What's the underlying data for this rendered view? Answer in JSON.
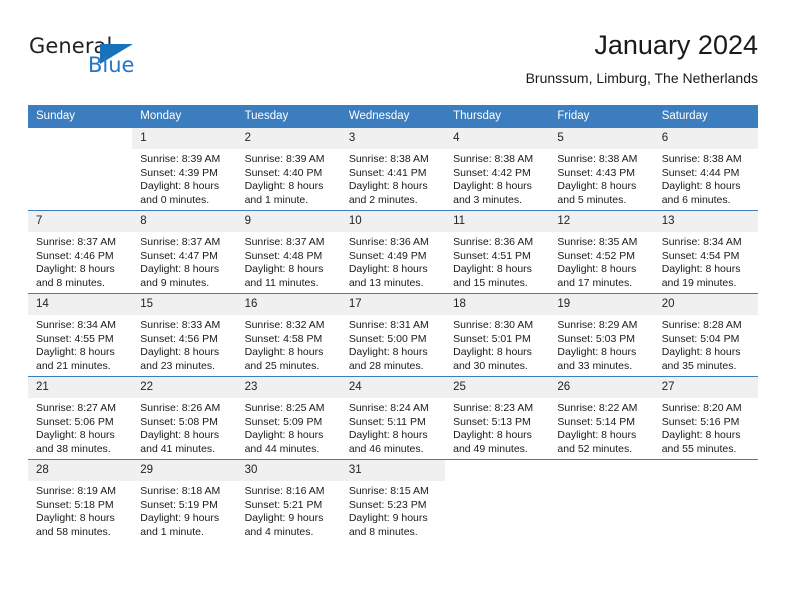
{
  "brand": {
    "name_part1": "General",
    "name_part2": "Blue",
    "logo_icon": "triangle-icon",
    "accent_color": "#1872bb"
  },
  "header": {
    "title": "January 2024",
    "subtitle": "Brunssum, Limburg, The Netherlands"
  },
  "theme": {
    "header_row_bg": "#3b7dbf",
    "day_number_bg": "#f0f0f0",
    "grid_line": "#3b7dbf"
  },
  "calendar": {
    "weekday_headers": [
      "Sunday",
      "Monday",
      "Tuesday",
      "Wednesday",
      "Thursday",
      "Friday",
      "Saturday"
    ],
    "weeks": [
      [
        {
          "day": "",
          "lines": []
        },
        {
          "day": "1",
          "lines": [
            "Sunrise: 8:39 AM",
            "Sunset: 4:39 PM",
            "Daylight: 8 hours",
            "and 0 minutes."
          ]
        },
        {
          "day": "2",
          "lines": [
            "Sunrise: 8:39 AM",
            "Sunset: 4:40 PM",
            "Daylight: 8 hours",
            "and 1 minute."
          ]
        },
        {
          "day": "3",
          "lines": [
            "Sunrise: 8:38 AM",
            "Sunset: 4:41 PM",
            "Daylight: 8 hours",
            "and 2 minutes."
          ]
        },
        {
          "day": "4",
          "lines": [
            "Sunrise: 8:38 AM",
            "Sunset: 4:42 PM",
            "Daylight: 8 hours",
            "and 3 minutes."
          ]
        },
        {
          "day": "5",
          "lines": [
            "Sunrise: 8:38 AM",
            "Sunset: 4:43 PM",
            "Daylight: 8 hours",
            "and 5 minutes."
          ]
        },
        {
          "day": "6",
          "lines": [
            "Sunrise: 8:38 AM",
            "Sunset: 4:44 PM",
            "Daylight: 8 hours",
            "and 6 minutes."
          ]
        }
      ],
      [
        {
          "day": "7",
          "lines": [
            "Sunrise: 8:37 AM",
            "Sunset: 4:46 PM",
            "Daylight: 8 hours",
            "and 8 minutes."
          ]
        },
        {
          "day": "8",
          "lines": [
            "Sunrise: 8:37 AM",
            "Sunset: 4:47 PM",
            "Daylight: 8 hours",
            "and 9 minutes."
          ]
        },
        {
          "day": "9",
          "lines": [
            "Sunrise: 8:37 AM",
            "Sunset: 4:48 PM",
            "Daylight: 8 hours",
            "and 11 minutes."
          ]
        },
        {
          "day": "10",
          "lines": [
            "Sunrise: 8:36 AM",
            "Sunset: 4:49 PM",
            "Daylight: 8 hours",
            "and 13 minutes."
          ]
        },
        {
          "day": "11",
          "lines": [
            "Sunrise: 8:36 AM",
            "Sunset: 4:51 PM",
            "Daylight: 8 hours",
            "and 15 minutes."
          ]
        },
        {
          "day": "12",
          "lines": [
            "Sunrise: 8:35 AM",
            "Sunset: 4:52 PM",
            "Daylight: 8 hours",
            "and 17 minutes."
          ]
        },
        {
          "day": "13",
          "lines": [
            "Sunrise: 8:34 AM",
            "Sunset: 4:54 PM",
            "Daylight: 8 hours",
            "and 19 minutes."
          ]
        }
      ],
      [
        {
          "day": "14",
          "lines": [
            "Sunrise: 8:34 AM",
            "Sunset: 4:55 PM",
            "Daylight: 8 hours",
            "and 21 minutes."
          ]
        },
        {
          "day": "15",
          "lines": [
            "Sunrise: 8:33 AM",
            "Sunset: 4:56 PM",
            "Daylight: 8 hours",
            "and 23 minutes."
          ]
        },
        {
          "day": "16",
          "lines": [
            "Sunrise: 8:32 AM",
            "Sunset: 4:58 PM",
            "Daylight: 8 hours",
            "and 25 minutes."
          ]
        },
        {
          "day": "17",
          "lines": [
            "Sunrise: 8:31 AM",
            "Sunset: 5:00 PM",
            "Daylight: 8 hours",
            "and 28 minutes."
          ]
        },
        {
          "day": "18",
          "lines": [
            "Sunrise: 8:30 AM",
            "Sunset: 5:01 PM",
            "Daylight: 8 hours",
            "and 30 minutes."
          ]
        },
        {
          "day": "19",
          "lines": [
            "Sunrise: 8:29 AM",
            "Sunset: 5:03 PM",
            "Daylight: 8 hours",
            "and 33 minutes."
          ]
        },
        {
          "day": "20",
          "lines": [
            "Sunrise: 8:28 AM",
            "Sunset: 5:04 PM",
            "Daylight: 8 hours",
            "and 35 minutes."
          ]
        }
      ],
      [
        {
          "day": "21",
          "lines": [
            "Sunrise: 8:27 AM",
            "Sunset: 5:06 PM",
            "Daylight: 8 hours",
            "and 38 minutes."
          ]
        },
        {
          "day": "22",
          "lines": [
            "Sunrise: 8:26 AM",
            "Sunset: 5:08 PM",
            "Daylight: 8 hours",
            "and 41 minutes."
          ]
        },
        {
          "day": "23",
          "lines": [
            "Sunrise: 8:25 AM",
            "Sunset: 5:09 PM",
            "Daylight: 8 hours",
            "and 44 minutes."
          ]
        },
        {
          "day": "24",
          "lines": [
            "Sunrise: 8:24 AM",
            "Sunset: 5:11 PM",
            "Daylight: 8 hours",
            "and 46 minutes."
          ]
        },
        {
          "day": "25",
          "lines": [
            "Sunrise: 8:23 AM",
            "Sunset: 5:13 PM",
            "Daylight: 8 hours",
            "and 49 minutes."
          ]
        },
        {
          "day": "26",
          "lines": [
            "Sunrise: 8:22 AM",
            "Sunset: 5:14 PM",
            "Daylight: 8 hours",
            "and 52 minutes."
          ]
        },
        {
          "day": "27",
          "lines": [
            "Sunrise: 8:20 AM",
            "Sunset: 5:16 PM",
            "Daylight: 8 hours",
            "and 55 minutes."
          ]
        }
      ],
      [
        {
          "day": "28",
          "lines": [
            "Sunrise: 8:19 AM",
            "Sunset: 5:18 PM",
            "Daylight: 8 hours",
            "and 58 minutes."
          ]
        },
        {
          "day": "29",
          "lines": [
            "Sunrise: 8:18 AM",
            "Sunset: 5:19 PM",
            "Daylight: 9 hours",
            "and 1 minute."
          ]
        },
        {
          "day": "30",
          "lines": [
            "Sunrise: 8:16 AM",
            "Sunset: 5:21 PM",
            "Daylight: 9 hours",
            "and 4 minutes."
          ]
        },
        {
          "day": "31",
          "lines": [
            "Sunrise: 8:15 AM",
            "Sunset: 5:23 PM",
            "Daylight: 9 hours",
            "and 8 minutes."
          ]
        },
        {
          "day": "",
          "lines": []
        },
        {
          "day": "",
          "lines": []
        },
        {
          "day": "",
          "lines": []
        }
      ]
    ]
  }
}
